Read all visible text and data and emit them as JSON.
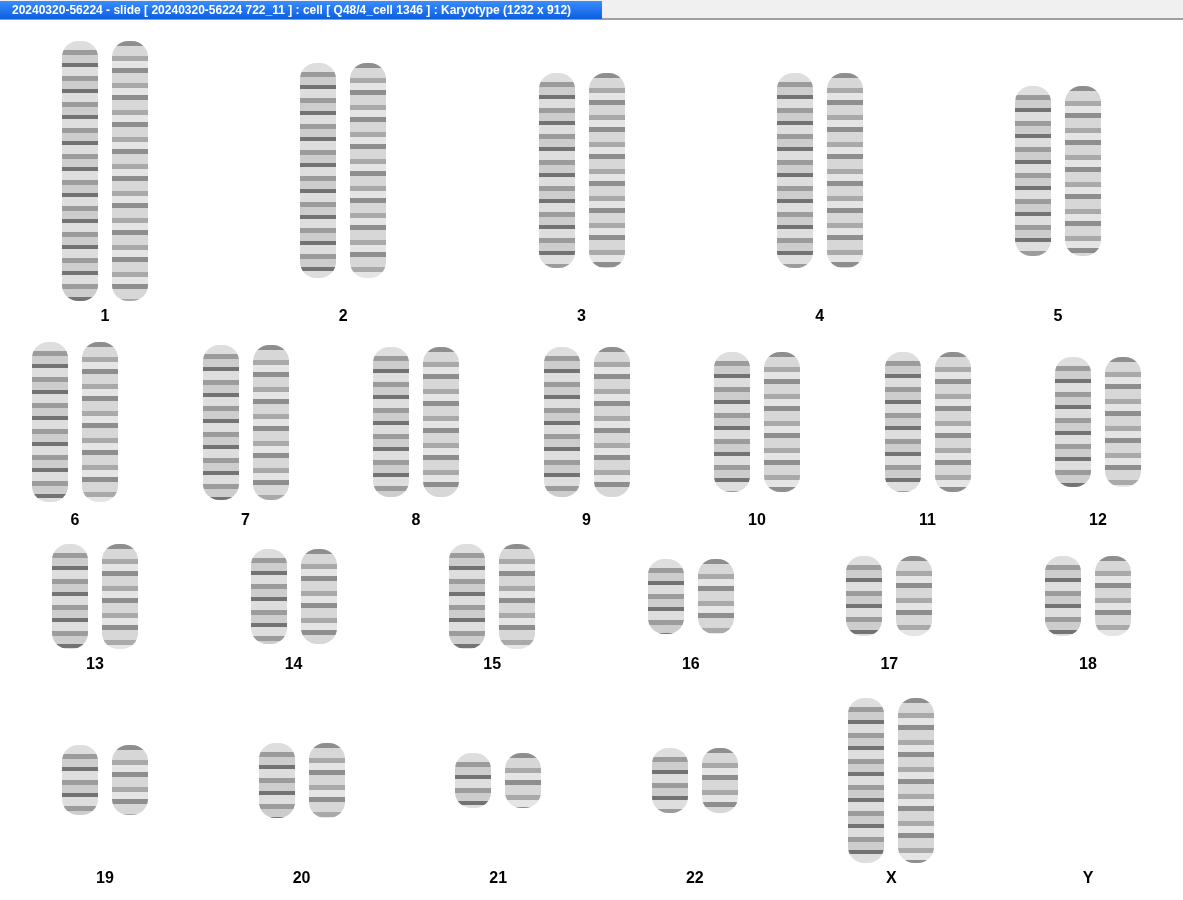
{
  "window": {
    "title": "20240320-56224 - slide [ 20240320-56224 722_11 ] : cell [ Q48/4_cell 1346 ] : Karyotype  (1232 x 912)"
  },
  "karyotype_rows": [
    {
      "pairs": [
        {
          "label": "1",
          "homologs": [
            {
              "kind": "chromosome"
            },
            {
              "kind": "chromosome"
            }
          ]
        },
        {
          "label": "2",
          "homologs": [
            {
              "kind": "chromosome"
            },
            {
              "kind": "chromosome"
            }
          ]
        },
        {
          "label": "3",
          "homologs": [
            {
              "kind": "chromosome"
            },
            {
              "kind": "chromosome"
            }
          ]
        },
        {
          "label": "4",
          "homologs": [
            {
              "kind": "chromosome"
            },
            {
              "kind": "chromosome"
            }
          ]
        },
        {
          "label": "5",
          "homologs": [
            {
              "kind": "chromosome"
            },
            {
              "kind": "chromosome"
            }
          ]
        }
      ]
    },
    {
      "pairs": [
        {
          "label": "6",
          "homologs": [
            {
              "kind": "chromosome"
            },
            {
              "kind": "chromosome"
            }
          ]
        },
        {
          "label": "7",
          "homologs": [
            {
              "kind": "chromosome"
            },
            {
              "kind": "chromosome"
            }
          ]
        },
        {
          "label": "8",
          "homologs": [
            {
              "kind": "chromosome"
            },
            {
              "kind": "chromosome"
            }
          ]
        },
        {
          "label": "9",
          "homologs": [
            {
              "kind": "chromosome"
            },
            {
              "kind": "chromosome"
            }
          ]
        },
        {
          "label": "10",
          "homologs": [
            {
              "kind": "chromosome"
            },
            {
              "kind": "chromosome"
            }
          ]
        },
        {
          "label": "11",
          "homologs": [
            {
              "kind": "chromosome"
            },
            {
              "kind": "chromosome"
            }
          ]
        },
        {
          "label": "12",
          "homologs": [
            {
              "kind": "chromosome"
            },
            {
              "kind": "chromosome"
            }
          ]
        }
      ]
    },
    {
      "pairs": [
        {
          "label": "13",
          "homologs": [
            {
              "kind": "chromosome"
            },
            {
              "kind": "chromosome"
            }
          ]
        },
        {
          "label": "14",
          "homologs": [
            {
              "kind": "chromosome"
            },
            {
              "kind": "chromosome"
            }
          ]
        },
        {
          "label": "15",
          "homologs": [
            {
              "kind": "chromosome"
            },
            {
              "kind": "chromosome"
            }
          ]
        },
        {
          "label": "16",
          "homologs": [
            {
              "kind": "chromosome"
            },
            {
              "kind": "chromosome"
            }
          ]
        },
        {
          "label": "17",
          "homologs": [
            {
              "kind": "chromosome"
            },
            {
              "kind": "chromosome"
            }
          ]
        },
        {
          "label": "18",
          "homologs": [
            {
              "kind": "chromosome"
            },
            {
              "kind": "chromosome"
            }
          ]
        }
      ]
    },
    {
      "pairs": [
        {
          "label": "19",
          "homologs": [
            {
              "kind": "chromosome"
            },
            {
              "kind": "chromosome"
            }
          ]
        },
        {
          "label": "20",
          "homologs": [
            {
              "kind": "chromosome"
            },
            {
              "kind": "chromosome"
            }
          ]
        },
        {
          "label": "21",
          "homologs": [
            {
              "kind": "chromosome"
            },
            {
              "kind": "chromosome"
            }
          ]
        },
        {
          "label": "22",
          "homologs": [
            {
              "kind": "chromosome"
            },
            {
              "kind": "chromosome"
            }
          ]
        },
        {
          "label": "X",
          "homologs": [
            {
              "kind": "chromosome"
            },
            {
              "kind": "chromosome"
            }
          ]
        },
        {
          "label": "Y"
        }
      ]
    }
  ]
}
